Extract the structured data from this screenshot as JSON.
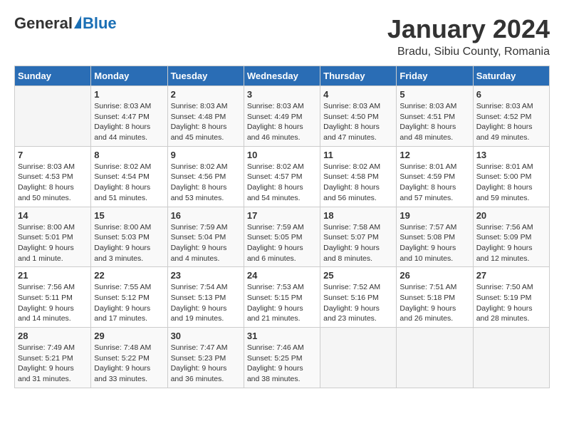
{
  "header": {
    "logo_general": "General",
    "logo_blue": "Blue",
    "month": "January 2024",
    "location": "Bradu, Sibiu County, Romania"
  },
  "weekdays": [
    "Sunday",
    "Monday",
    "Tuesday",
    "Wednesday",
    "Thursday",
    "Friday",
    "Saturday"
  ],
  "weeks": [
    [
      {
        "day": "",
        "info": ""
      },
      {
        "day": "1",
        "info": "Sunrise: 8:03 AM\nSunset: 4:47 PM\nDaylight: 8 hours\nand 44 minutes."
      },
      {
        "day": "2",
        "info": "Sunrise: 8:03 AM\nSunset: 4:48 PM\nDaylight: 8 hours\nand 45 minutes."
      },
      {
        "day": "3",
        "info": "Sunrise: 8:03 AM\nSunset: 4:49 PM\nDaylight: 8 hours\nand 46 minutes."
      },
      {
        "day": "4",
        "info": "Sunrise: 8:03 AM\nSunset: 4:50 PM\nDaylight: 8 hours\nand 47 minutes."
      },
      {
        "day": "5",
        "info": "Sunrise: 8:03 AM\nSunset: 4:51 PM\nDaylight: 8 hours\nand 48 minutes."
      },
      {
        "day": "6",
        "info": "Sunrise: 8:03 AM\nSunset: 4:52 PM\nDaylight: 8 hours\nand 49 minutes."
      }
    ],
    [
      {
        "day": "7",
        "info": "Sunrise: 8:03 AM\nSunset: 4:53 PM\nDaylight: 8 hours\nand 50 minutes."
      },
      {
        "day": "8",
        "info": "Sunrise: 8:02 AM\nSunset: 4:54 PM\nDaylight: 8 hours\nand 51 minutes."
      },
      {
        "day": "9",
        "info": "Sunrise: 8:02 AM\nSunset: 4:56 PM\nDaylight: 8 hours\nand 53 minutes."
      },
      {
        "day": "10",
        "info": "Sunrise: 8:02 AM\nSunset: 4:57 PM\nDaylight: 8 hours\nand 54 minutes."
      },
      {
        "day": "11",
        "info": "Sunrise: 8:02 AM\nSunset: 4:58 PM\nDaylight: 8 hours\nand 56 minutes."
      },
      {
        "day": "12",
        "info": "Sunrise: 8:01 AM\nSunset: 4:59 PM\nDaylight: 8 hours\nand 57 minutes."
      },
      {
        "day": "13",
        "info": "Sunrise: 8:01 AM\nSunset: 5:00 PM\nDaylight: 8 hours\nand 59 minutes."
      }
    ],
    [
      {
        "day": "14",
        "info": "Sunrise: 8:00 AM\nSunset: 5:01 PM\nDaylight: 9 hours\nand 1 minute."
      },
      {
        "day": "15",
        "info": "Sunrise: 8:00 AM\nSunset: 5:03 PM\nDaylight: 9 hours\nand 3 minutes."
      },
      {
        "day": "16",
        "info": "Sunrise: 7:59 AM\nSunset: 5:04 PM\nDaylight: 9 hours\nand 4 minutes."
      },
      {
        "day": "17",
        "info": "Sunrise: 7:59 AM\nSunset: 5:05 PM\nDaylight: 9 hours\nand 6 minutes."
      },
      {
        "day": "18",
        "info": "Sunrise: 7:58 AM\nSunset: 5:07 PM\nDaylight: 9 hours\nand 8 minutes."
      },
      {
        "day": "19",
        "info": "Sunrise: 7:57 AM\nSunset: 5:08 PM\nDaylight: 9 hours\nand 10 minutes."
      },
      {
        "day": "20",
        "info": "Sunrise: 7:56 AM\nSunset: 5:09 PM\nDaylight: 9 hours\nand 12 minutes."
      }
    ],
    [
      {
        "day": "21",
        "info": "Sunrise: 7:56 AM\nSunset: 5:11 PM\nDaylight: 9 hours\nand 14 minutes."
      },
      {
        "day": "22",
        "info": "Sunrise: 7:55 AM\nSunset: 5:12 PM\nDaylight: 9 hours\nand 17 minutes."
      },
      {
        "day": "23",
        "info": "Sunrise: 7:54 AM\nSunset: 5:13 PM\nDaylight: 9 hours\nand 19 minutes."
      },
      {
        "day": "24",
        "info": "Sunrise: 7:53 AM\nSunset: 5:15 PM\nDaylight: 9 hours\nand 21 minutes."
      },
      {
        "day": "25",
        "info": "Sunrise: 7:52 AM\nSunset: 5:16 PM\nDaylight: 9 hours\nand 23 minutes."
      },
      {
        "day": "26",
        "info": "Sunrise: 7:51 AM\nSunset: 5:18 PM\nDaylight: 9 hours\nand 26 minutes."
      },
      {
        "day": "27",
        "info": "Sunrise: 7:50 AM\nSunset: 5:19 PM\nDaylight: 9 hours\nand 28 minutes."
      }
    ],
    [
      {
        "day": "28",
        "info": "Sunrise: 7:49 AM\nSunset: 5:21 PM\nDaylight: 9 hours\nand 31 minutes."
      },
      {
        "day": "29",
        "info": "Sunrise: 7:48 AM\nSunset: 5:22 PM\nDaylight: 9 hours\nand 33 minutes."
      },
      {
        "day": "30",
        "info": "Sunrise: 7:47 AM\nSunset: 5:23 PM\nDaylight: 9 hours\nand 36 minutes."
      },
      {
        "day": "31",
        "info": "Sunrise: 7:46 AM\nSunset: 5:25 PM\nDaylight: 9 hours\nand 38 minutes."
      },
      {
        "day": "",
        "info": ""
      },
      {
        "day": "",
        "info": ""
      },
      {
        "day": "",
        "info": ""
      }
    ]
  ]
}
